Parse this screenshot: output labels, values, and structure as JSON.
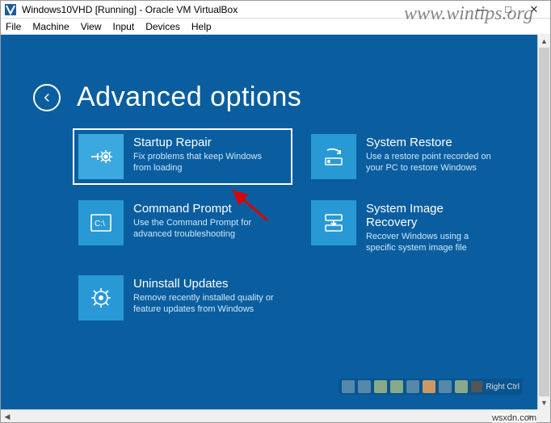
{
  "window": {
    "title": "Windows10VHD [Running] - Oracle VM VirtualBox",
    "minimize": "—",
    "maximize": "□",
    "close": "✕"
  },
  "menu": {
    "file": "File",
    "machine": "Machine",
    "view": "View",
    "input": "Input",
    "devices": "Devices",
    "help": "Help"
  },
  "page": {
    "title": "Advanced options"
  },
  "tiles": [
    {
      "title": "Startup Repair",
      "desc": "Fix problems that keep Windows from loading",
      "selected": true,
      "icon": "wrench-gear"
    },
    {
      "title": "System Restore",
      "desc": "Use a restore point recorded on your PC to restore Windows",
      "selected": false,
      "icon": "drive-restore"
    },
    {
      "title": "Command Prompt",
      "desc": "Use the Command Prompt for advanced troubleshooting",
      "selected": false,
      "icon": "cmd"
    },
    {
      "title": "System Image Recovery",
      "desc": "Recover Windows using a specific system image file",
      "selected": false,
      "icon": "drive-arrow"
    },
    {
      "title": "Uninstall Updates",
      "desc": "Remove recently installed quality or feature updates from Windows",
      "selected": false,
      "icon": "gear"
    }
  ],
  "status": {
    "host_key": "Right Ctrl"
  },
  "watermark": "www.wintips.org",
  "wsx": "wsxdn.com"
}
